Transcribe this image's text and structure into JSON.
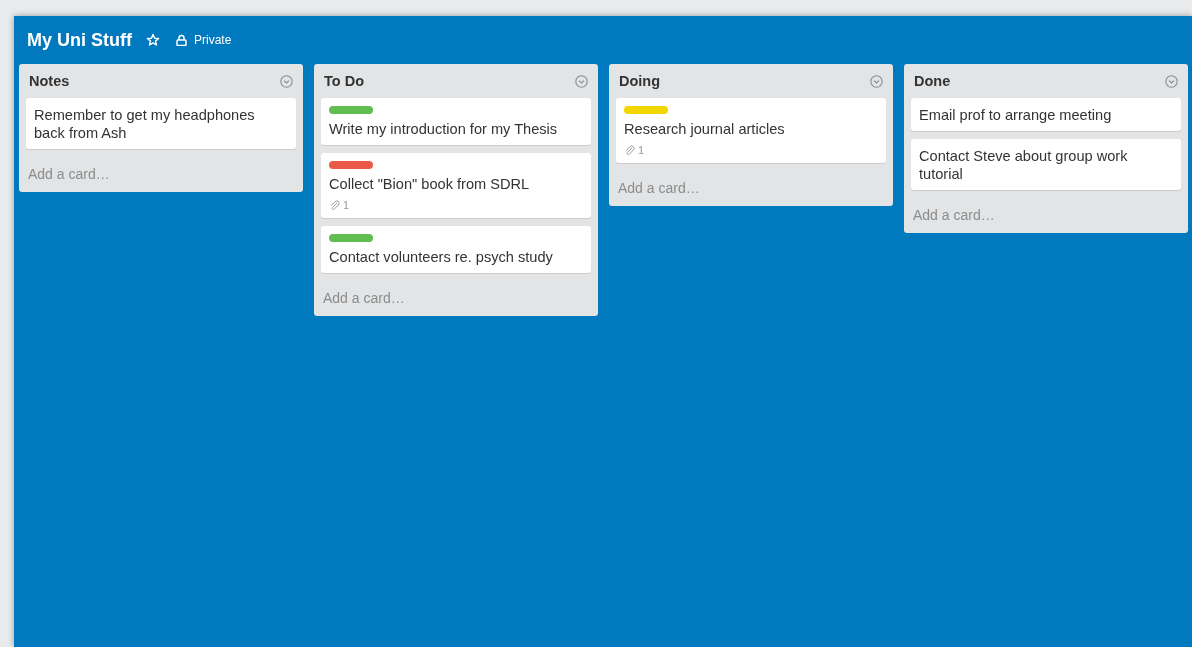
{
  "board": {
    "title": "My Uni Stuff",
    "starred": false,
    "visibility": "Private"
  },
  "lists": [
    {
      "name": "Notes",
      "cards": [
        {
          "title": "Remember to get my headphones back from Ash"
        }
      ],
      "add_card": "Add a card…"
    },
    {
      "name": "To Do",
      "cards": [
        {
          "title": "Write my introduction for my Thesis",
          "color": "#61bd4f"
        },
        {
          "title": "Collect \"Bion\" book from SDRL",
          "color": "#eb5a46",
          "attachments": "1"
        },
        {
          "title": "Contact volunteers re. psych study",
          "color": "#61bd4f"
        }
      ],
      "add_card": "Add a card…"
    },
    {
      "name": "Doing",
      "cards": [
        {
          "title": "Research journal articles",
          "color": "#f2d600",
          "attachments": "1"
        }
      ],
      "add_card": "Add a card…"
    },
    {
      "name": "Done",
      "cards": [
        {
          "title": "Email prof to arrange meeting"
        },
        {
          "title": "Contact Steve about group work tutorial"
        }
      ],
      "add_card": "Add a card…"
    }
  ]
}
